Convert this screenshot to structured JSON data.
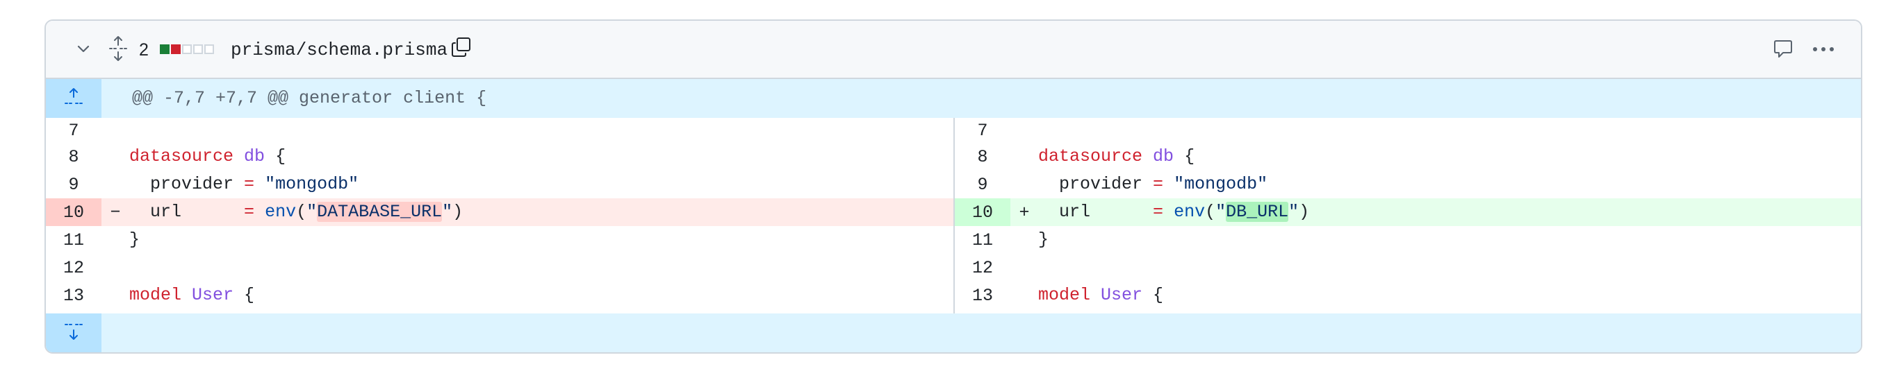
{
  "header": {
    "change_count": "2",
    "diffstat": [
      "add",
      "del",
      "neutral",
      "neutral",
      "neutral"
    ],
    "file_path": "prisma/schema.prisma",
    "icons": {
      "collapse": "chevron-down-icon",
      "expand_all": "unfold-icon",
      "copy": "copy-icon",
      "comment": "comment-icon",
      "more": "kebab-horizontal-icon"
    }
  },
  "hunk": {
    "header_text": "@@ -7,7 +7,7 @@ generator client {"
  },
  "left": {
    "rows": [
      {
        "ln": "7",
        "marker": "",
        "parts": [
          {
            "t": "",
            "c": ""
          }
        ]
      },
      {
        "ln": "8",
        "marker": "",
        "parts": [
          {
            "t": "datasource",
            "c": "kw"
          },
          {
            "t": " ",
            "c": ""
          },
          {
            "t": "db",
            "c": "ent"
          },
          {
            "t": " {",
            "c": ""
          }
        ]
      },
      {
        "ln": "9",
        "marker": "",
        "parts": [
          {
            "t": "  provider ",
            "c": ""
          },
          {
            "t": "=",
            "c": "op"
          },
          {
            "t": " ",
            "c": ""
          },
          {
            "t": "\"mongodb\"",
            "c": "str"
          }
        ]
      },
      {
        "ln": "10",
        "marker": "−",
        "type": "del",
        "parts": [
          {
            "t": "  url      ",
            "c": ""
          },
          {
            "t": "=",
            "c": "op"
          },
          {
            "t": " ",
            "c": ""
          },
          {
            "t": "env",
            "c": "fn"
          },
          {
            "t": "(",
            "c": ""
          },
          {
            "t": "\"",
            "c": "str"
          },
          {
            "t": "DATABASE_URL",
            "c": "str hl-del"
          },
          {
            "t": "\"",
            "c": "str"
          },
          {
            "t": ")",
            "c": ""
          }
        ]
      },
      {
        "ln": "11",
        "marker": "",
        "parts": [
          {
            "t": "}",
            "c": ""
          }
        ]
      },
      {
        "ln": "12",
        "marker": "",
        "parts": [
          {
            "t": "",
            "c": ""
          }
        ]
      },
      {
        "ln": "13",
        "marker": "",
        "parts": [
          {
            "t": "model",
            "c": "kw"
          },
          {
            "t": " ",
            "c": ""
          },
          {
            "t": "User",
            "c": "ent"
          },
          {
            "t": " {",
            "c": ""
          }
        ]
      }
    ]
  },
  "right": {
    "rows": [
      {
        "ln": "7",
        "marker": "",
        "parts": [
          {
            "t": "",
            "c": ""
          }
        ]
      },
      {
        "ln": "8",
        "marker": "",
        "parts": [
          {
            "t": "datasource",
            "c": "kw"
          },
          {
            "t": " ",
            "c": ""
          },
          {
            "t": "db",
            "c": "ent"
          },
          {
            "t": " {",
            "c": ""
          }
        ]
      },
      {
        "ln": "9",
        "marker": "",
        "parts": [
          {
            "t": "  provider ",
            "c": ""
          },
          {
            "t": "=",
            "c": "op"
          },
          {
            "t": " ",
            "c": ""
          },
          {
            "t": "\"mongodb\"",
            "c": "str"
          }
        ]
      },
      {
        "ln": "10",
        "marker": "+",
        "type": "add",
        "parts": [
          {
            "t": "  url      ",
            "c": ""
          },
          {
            "t": "=",
            "c": "op"
          },
          {
            "t": " ",
            "c": ""
          },
          {
            "t": "env",
            "c": "fn"
          },
          {
            "t": "(",
            "c": ""
          },
          {
            "t": "\"",
            "c": "str"
          },
          {
            "t": "DB_URL",
            "c": "str hl-add"
          },
          {
            "t": "\"",
            "c": "str"
          },
          {
            "t": ")",
            "c": ""
          }
        ]
      },
      {
        "ln": "11",
        "marker": "",
        "parts": [
          {
            "t": "}",
            "c": ""
          }
        ]
      },
      {
        "ln": "12",
        "marker": "",
        "parts": [
          {
            "t": "",
            "c": ""
          }
        ]
      },
      {
        "ln": "13",
        "marker": "",
        "parts": [
          {
            "t": "model",
            "c": "kw"
          },
          {
            "t": " ",
            "c": ""
          },
          {
            "t": "User",
            "c": "ent"
          },
          {
            "t": " {",
            "c": ""
          }
        ]
      }
    ]
  },
  "colors": {
    "deletion_bg": "#ffebe9",
    "deletion_gutter": "#ffcecb",
    "addition_bg": "#e6ffec",
    "addition_gutter": "#ccffd8",
    "hunk_bg": "#ddf4ff",
    "hunk_gutter": "#b6e3ff"
  }
}
